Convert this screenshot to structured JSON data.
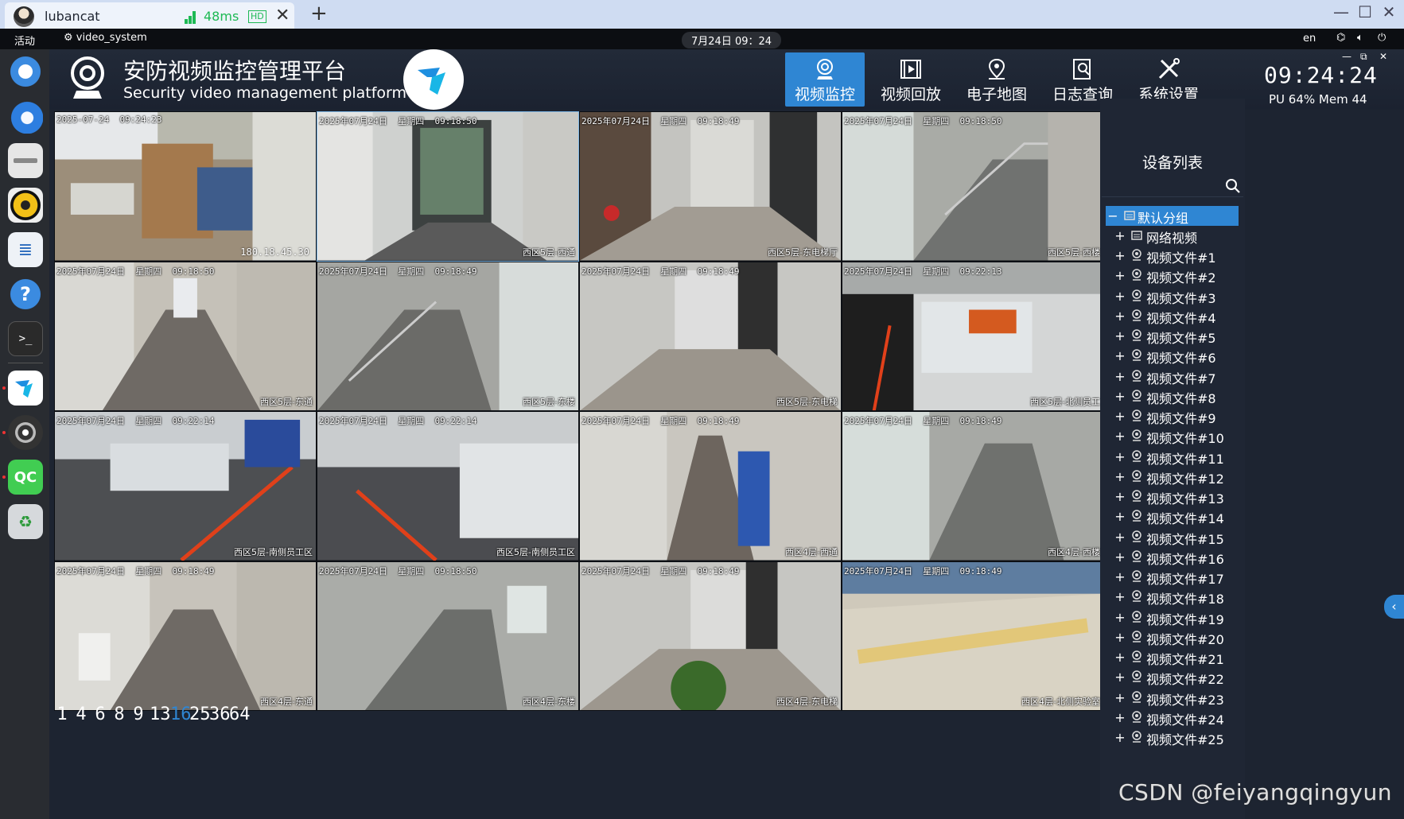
{
  "client": {
    "tab_title": "lubancat",
    "ping": "48ms",
    "hd_label": "HD",
    "new_tab_symbol": "+",
    "window_controls": [
      "—",
      "☐",
      "✕"
    ]
  },
  "panel": {
    "activities": "活动",
    "app_name": "video_system",
    "clock": "7月24日 09：24",
    "lang": "en"
  },
  "dock": {
    "items": [
      "chromium-icon",
      "thunderbird-icon",
      "files-icon",
      "rhythmbox-icon",
      "document-viewer-icon",
      "help-icon",
      "terminal-icon",
      "video-system-icon",
      "camera-icon",
      "qt-creator-icon",
      "trash-icon"
    ],
    "qt_label": "QC"
  },
  "header": {
    "title_cn": "安防视频监控管理平台",
    "title_en": "Security video management platform",
    "nav": [
      {
        "label": "视频监控",
        "icon": "monitor-camera-icon",
        "active": true
      },
      {
        "label": "视频回放",
        "icon": "playback-icon",
        "active": false
      },
      {
        "label": "电子地图",
        "icon": "map-pin-icon",
        "active": false
      },
      {
        "label": "日志查询",
        "icon": "log-search-icon",
        "active": false
      },
      {
        "label": "系统设置",
        "icon": "settings-tools-icon",
        "active": false
      }
    ],
    "mini_controls": [
      "—",
      "⧉",
      "✕"
    ],
    "time": "09:24:24",
    "stats": "PU 64%  Mem 44"
  },
  "cameras": [
    {
      "ts": "2025-07-24  09:24:23",
      "loc": "",
      "ip": "180.18.45.30",
      "scene": "office"
    },
    {
      "ts": "2025年07月24日  星期四  09:18:50",
      "loc": "西区5层-西通",
      "scene": "door"
    },
    {
      "ts": "2025年07月24日  星期四  09:18:49",
      "loc": "西区5层-东电梯厅",
      "scene": "elevator"
    },
    {
      "ts": "2025年07月24日  星期四  09:18:50",
      "loc": "西区5层-西楼",
      "scene": "stairs"
    },
    {
      "ts": "2025年07月24日  星期四  09:18:50",
      "loc": "西区5层-东通",
      "scene": "corridor"
    },
    {
      "ts": "2025年07月24日  星期四  09:18:49",
      "loc": "西区5层-东楼",
      "scene": "stairs2"
    },
    {
      "ts": "2025年07月24日  星期四  09:18:49",
      "loc": "西区5层-东电梯",
      "scene": "elevator2"
    },
    {
      "ts": "2025年07月24日  星期四  09:22:13",
      "loc": "西区5层-北侧员工",
      "scene": "lobby"
    },
    {
      "ts": "2025年07月24日  星期四  09:22:14",
      "loc": "西区5层-南侧员工区",
      "scene": "lobby2"
    },
    {
      "ts": "2025年07月24日  星期四  09:22:14",
      "loc": "西区5层-南侧员工区",
      "scene": "lobby3"
    },
    {
      "ts": "2025年07月24日  星期四  09:18:49",
      "loc": "西区4层-西通",
      "scene": "hall"
    },
    {
      "ts": "2025年07月24日  星期四  09:18:49",
      "loc": "西区4层-西楼",
      "scene": "stairs3"
    },
    {
      "ts": "2025年07月24日  星期四  09:18:49",
      "loc": "西区4层-东通",
      "scene": "corridor2"
    },
    {
      "ts": "2025年07月24日  星期四  09:18:50",
      "loc": "西区4层-东楼",
      "scene": "stairs4"
    },
    {
      "ts": "2025年07月24日  星期四  09:18:49",
      "loc": "西区4层-东电梯",
      "scene": "elevator3"
    },
    {
      "ts": "2025年07月24日  星期四  09:18:49",
      "loc": "西区4层-北侧实验室",
      "scene": "box"
    }
  ],
  "layouts": {
    "options": [
      "1",
      "4",
      "6",
      "8",
      "9",
      "13",
      "16",
      "25",
      "36",
      "64"
    ],
    "active": "16"
  },
  "devices": {
    "title": "设备列表",
    "root_label": "默认分组",
    "network_label": "网络视频",
    "files": [
      "视频文件#1",
      "视频文件#2",
      "视频文件#3",
      "视频文件#4",
      "视频文件#5",
      "视频文件#6",
      "视频文件#7",
      "视频文件#8",
      "视频文件#9",
      "视频文件#10",
      "视频文件#11",
      "视频文件#12",
      "视频文件#13",
      "视频文件#14",
      "视频文件#15",
      "视频文件#16",
      "视频文件#17",
      "视频文件#18",
      "视频文件#19",
      "视频文件#20",
      "视频文件#21",
      "视频文件#22",
      "视频文件#23",
      "视频文件#24",
      "视频文件#25"
    ]
  },
  "collapse_symbol": "‹",
  "watermark": "CSDN @feiyangqingyun",
  "colors": {
    "accent": "#2f86d3",
    "bg": "#1d2431",
    "signal": "#1db954"
  }
}
